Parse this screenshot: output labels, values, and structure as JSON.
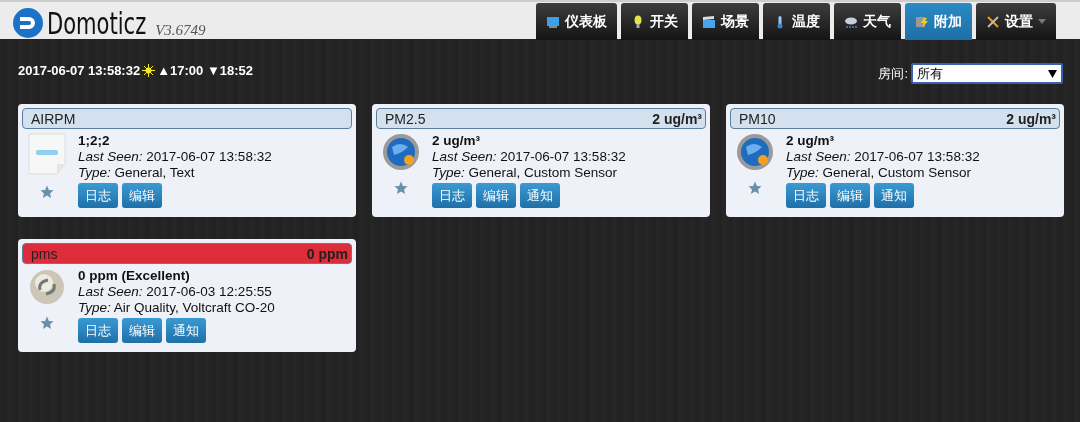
{
  "brand": {
    "name": "Domoticz",
    "version": "V3.6749"
  },
  "nav": [
    {
      "label": "仪表板",
      "kind": "monitor",
      "selected": false,
      "dropdown": false
    },
    {
      "label": "开关",
      "kind": "bulb",
      "selected": false,
      "dropdown": false
    },
    {
      "label": "场景",
      "kind": "clapper",
      "selected": false,
      "dropdown": false
    },
    {
      "label": "温度",
      "kind": "thermometer",
      "selected": false,
      "dropdown": false
    },
    {
      "label": "天气",
      "kind": "cloud",
      "selected": false,
      "dropdown": false
    },
    {
      "label": "附加",
      "kind": "utility",
      "selected": true,
      "dropdown": false
    },
    {
      "label": "设置",
      "kind": "tools",
      "selected": false,
      "dropdown": true
    }
  ],
  "clock": {
    "datetime": "2017-06-07 13:58:32",
    "sun": "▲17:00 ▼18:52"
  },
  "room_filter": {
    "label": "房间:",
    "value": "所有"
  },
  "devices": [
    {
      "name": "AIRPM",
      "color": "#d3e1ee",
      "kind": "text",
      "value": "1;2;2",
      "last_seen": "*Last Seen:* 2017-06-07 13:58:32",
      "type": "*Type:* General, Text",
      "favorite": false,
      "buttons": [
        "日志",
        "编辑"
      ]
    },
    {
      "name": "PM2.5",
      "reading": "2 ug/m³",
      "color": "#d3e1ee",
      "kind": "globe",
      "value": "2 ug/m³",
      "last_seen": "*Last Seen:* 2017-06-07 13:58:32",
      "type": "*Type:* General, Custom Sensor",
      "favorite": false,
      "buttons": [
        "日志",
        "编辑",
        "通知"
      ]
    },
    {
      "name": "PM10",
      "reading": "2 ug/m³",
      "color": "#d3e1ee",
      "kind": "globe",
      "value": "2 ug/m³",
      "last_seen": "*Last Seen:* 2017-06-07 13:58:32",
      "type": "*Type:* General, Custom Sensor",
      "favorite": false,
      "buttons": [
        "日志",
        "编辑",
        "通知"
      ]
    },
    {
      "name": "pms",
      "reading": "0 ppm",
      "color": "#dd2c3a",
      "kind": "sphere",
      "value": "0 ppm (Excellent)",
      "last_seen": "*Last Seen:* 2017-06-03 12:25:55",
      "type": "*Type:* Air Quality, Voltcraft CO-20",
      "favorite": false,
      "buttons": [
        "日志",
        "编辑",
        "通知"
      ]
    }
  ]
}
